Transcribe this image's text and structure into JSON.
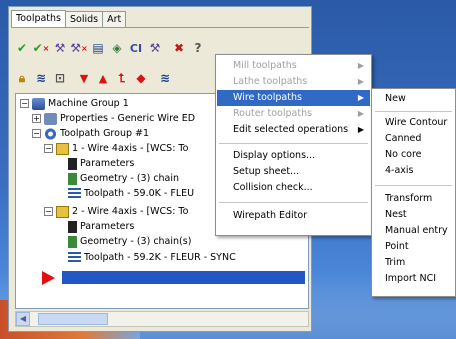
{
  "tabs": [
    "Toolpaths",
    "Solids",
    "Art"
  ],
  "tree": {
    "machine_group": "Machine Group 1",
    "properties": "Properties - Generic Wire ED",
    "toolpath_group": "Toolpath Group #1",
    "op1": "1 - Wire 4axis - [WCS: To",
    "op1_parameters": "Parameters",
    "op1_geometry": "Geometry - (3) chain",
    "op1_toolpath": "Toolpath - 59.0K - FLEU",
    "op2": "2 - Wire 4axis - [WCS: To",
    "op2_parameters": "Parameters",
    "op2_geometry": "Geometry - (3) chain(s)",
    "op2_toolpath": "Toolpath - 59.2K - FLEUR - SYNC"
  },
  "context_menu": {
    "mill": "Mill toolpaths",
    "lathe": "Lathe toolpaths",
    "wire": "Wire toolpaths",
    "router": "Router toolpaths",
    "edit_selected": "Edit selected operations",
    "display_options": "Display options...",
    "setup_sheet": "Setup sheet...",
    "collision_check": "Collision check...",
    "wirepath_editor": "Wirepath Editor"
  },
  "wire_submenu": {
    "new": "New",
    "wire_contour": "Wire Contour",
    "canned": "Canned",
    "no_core": "No core",
    "four_axis": "4-axis",
    "transform": "Transform",
    "nest": "Nest",
    "manual_entry": "Manual entry",
    "point": "Point",
    "trim": "Trim",
    "import_nci": "Import NCI"
  },
  "toolbar1": {
    "ci_label": "CI"
  },
  "colors": {
    "highlight": "#316ac5",
    "accent_red": "#e01010",
    "check_green": "#2e9a2e"
  }
}
